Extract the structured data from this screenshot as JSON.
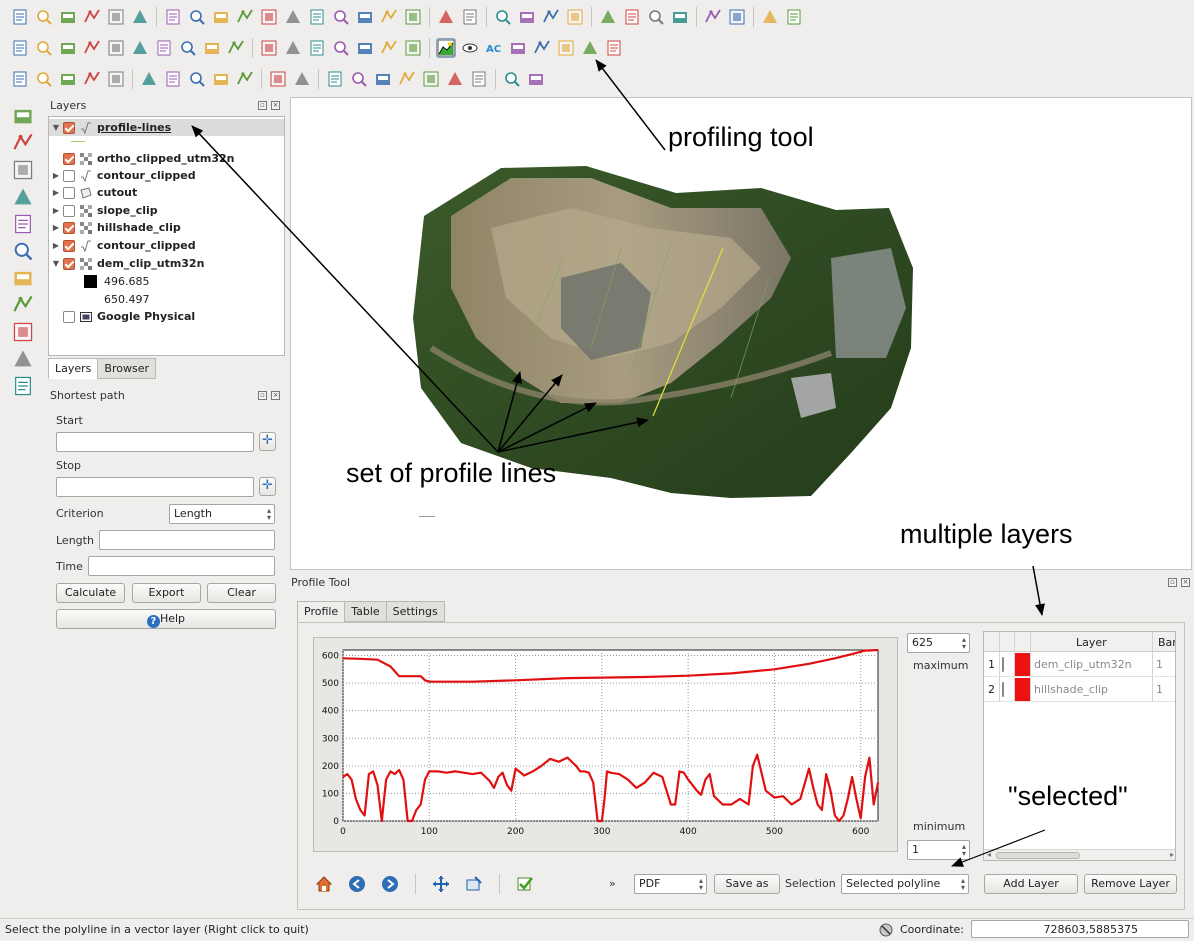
{
  "toolbar_rows": {
    "row1": [
      "new-project-icon",
      "open-project-icon",
      "save-project-icon",
      "save-as-icon",
      "new-print-composer-icon",
      "composer-manager-icon",
      "pan-icon",
      "pan-to-selection-icon",
      "zoom-in-icon",
      "zoom-out-icon",
      "zoom-actual-icon",
      "zoom-full-icon",
      "zoom-to-selection-icon",
      "zoom-to-layer-icon",
      "zoom-last-icon",
      "zoom-next-icon",
      "refresh-icon",
      "identify-icon",
      "action-icon",
      "select-features-icon",
      "deselect-icon",
      "expression-select-icon",
      "attribute-table-icon",
      "field-calculator-icon",
      "measure-icon",
      "map-tips-icon",
      "new-bookmark-icon",
      "show-bookmarks-icon",
      "text-annotation-icon",
      "help-icon",
      "whats-this-icon"
    ],
    "row2": [
      "digitize-icon",
      "edit-pencil-icon",
      "save-edits-icon",
      "add-feature-icon",
      "move-feature-icon",
      "node-tool-icon",
      "delete-selected-icon",
      "cut-features-icon",
      "copy-features-icon",
      "paste-features-icon",
      "label-icon",
      "label-pin-icon",
      "label-show-hide-icon",
      "label-move-icon",
      "label-rotate-icon",
      "label-change-icon",
      "label-highlight-icon",
      "profile-tool-icon",
      "eye-icon",
      "ac-icon",
      "binoculars-icon",
      "flag-icon",
      "terrain-icon",
      "contour-icon",
      "scatter-icon"
    ],
    "row3": [
      "add-vector-layer-icon",
      "add-raster-layer-icon",
      "add-postgis-icon",
      "add-spatialite-icon",
      "add-mssql-icon",
      "add-oracle-icon",
      "add-wms-icon",
      "add-wcs-icon",
      "add-wfs-icon",
      "add-delimited-icon",
      "new-shapefile-icon",
      "new-spatialite-icon",
      "simplify-icon",
      "add-ring-icon",
      "add-part-icon",
      "fill-ring-icon",
      "reshape-icon",
      "offset-curve-icon",
      "split-features-icon",
      "capture-icon",
      "capture-polygon-icon"
    ]
  },
  "left_toolbar": [
    "digitize-vertex-icon",
    "raster-grid-icon",
    "database-icon",
    "feather-icon",
    "shape-icon",
    "globe-icon",
    "globe2-icon",
    "globe3-icon",
    "route-icon",
    "vertex-add-icon",
    "rectangle-red-icon"
  ],
  "layers_panel": {
    "title": "Layers",
    "items": [
      {
        "name": "profile-lines",
        "checked": true,
        "expanded": true,
        "type": "line"
      },
      {
        "name": "ortho_clipped_utm32n",
        "checked": true,
        "expanded": false,
        "type": "raster"
      },
      {
        "name": "contour_clipped",
        "checked": false,
        "expanded": false,
        "type": "line"
      },
      {
        "name": "cutout",
        "checked": false,
        "expanded": false,
        "type": "polygon"
      },
      {
        "name": "slope_clip",
        "checked": false,
        "expanded": false,
        "type": "raster"
      },
      {
        "name": "hillshade_clip",
        "checked": true,
        "expanded": false,
        "type": "raster"
      },
      {
        "name": "contour_clipped",
        "checked": true,
        "expanded": false,
        "type": "line"
      },
      {
        "name": "dem_clip_utm32n",
        "checked": true,
        "expanded": true,
        "type": "raster"
      },
      {
        "name": "Google Physical",
        "checked": false,
        "expanded": false,
        "type": "web"
      }
    ],
    "dem_legend": {
      "min": "496.685",
      "max": "650.497"
    },
    "tabs": [
      "Layers",
      "Browser"
    ]
  },
  "shortest_path": {
    "title": "Shortest path",
    "start_label": "Start",
    "stop_label": "Stop",
    "criterion_label": "Criterion",
    "criterion_value": "Length",
    "length_label": "Length",
    "time_label": "Time",
    "calculate": "Calculate",
    "export": "Export",
    "clear": "Clear",
    "help": "Help"
  },
  "profile_tool": {
    "title": "Profile Tool",
    "tabs": [
      "Profile",
      "Table",
      "Settings"
    ],
    "max_value": "625",
    "max_label": "maximum",
    "min_value": "1",
    "min_label": "minimum",
    "format": "PDF",
    "save_as": "Save as",
    "selection_label": "Selection",
    "selection_value": "Selected polyline",
    "add_layer": "Add Layer",
    "remove_layer": "Remove Layer",
    "more_glyph": "»",
    "table_headers": [
      "Layer",
      "Bar"
    ],
    "table_rows": [
      {
        "idx": "1",
        "layer": "dem_clip_utm32n",
        "band": "1",
        "color": "#ee1111"
      },
      {
        "idx": "2",
        "layer": "hillshade_clip",
        "band": "1",
        "color": "#ee1111"
      }
    ]
  },
  "chart_data": {
    "type": "line",
    "xlabel": "",
    "ylabel": "",
    "xlim": [
      0,
      620
    ],
    "ylim": [
      0,
      620
    ],
    "x_ticks": [
      0,
      100,
      200,
      300,
      400,
      500,
      600
    ],
    "y_ticks": [
      0,
      100,
      200,
      300,
      400,
      500,
      600
    ],
    "series": [
      {
        "color": "#e01010",
        "x": [
          0,
          20,
          40,
          55,
          65,
          75,
          90,
          95,
          100,
          150,
          200,
          260,
          300,
          350,
          400,
          450,
          500,
          540,
          570,
          590,
          605,
          620
        ],
        "y": [
          590,
          588,
          585,
          560,
          525,
          525,
          525,
          510,
          505,
          505,
          510,
          518,
          520,
          522,
          527,
          535,
          550,
          570,
          590,
          605,
          618,
          625
        ]
      },
      {
        "color": "#e01010",
        "x": [
          0,
          5,
          10,
          15,
          20,
          25,
          30,
          35,
          40,
          45,
          50,
          55,
          60,
          65,
          70,
          75,
          80,
          85,
          90,
          95,
          100,
          110,
          120,
          130,
          140,
          150,
          160,
          170,
          175,
          180,
          185,
          190,
          195,
          200,
          210,
          220,
          230,
          240,
          250,
          260,
          270,
          275,
          280,
          285,
          290,
          295,
          300,
          303,
          306,
          310,
          320,
          330,
          340,
          350,
          360,
          370,
          380,
          385,
          390,
          395,
          400,
          410,
          415,
          420,
          425,
          430,
          440,
          450,
          460,
          470,
          475,
          480,
          490,
          500,
          510,
          520,
          530,
          540,
          545,
          550,
          555,
          560,
          565,
          570,
          575,
          580,
          585,
          590,
          595,
          600,
          605,
          610,
          615,
          620
        ],
        "y": [
          160,
          170,
          150,
          80,
          40,
          20,
          170,
          180,
          130,
          0,
          150,
          180,
          170,
          185,
          150,
          0,
          0,
          40,
          60,
          150,
          180,
          180,
          175,
          180,
          175,
          170,
          175,
          145,
          120,
          160,
          175,
          130,
          110,
          190,
          165,
          180,
          200,
          225,
          215,
          230,
          200,
          180,
          180,
          175,
          140,
          0,
          0,
          80,
          180,
          175,
          170,
          150,
          120,
          140,
          175,
          160,
          60,
          60,
          180,
          175,
          150,
          110,
          95,
          150,
          170,
          90,
          60,
          60,
          80,
          60,
          200,
          240,
          110,
          85,
          90,
          60,
          80,
          190,
          120,
          60,
          40,
          170,
          110,
          20,
          0,
          20,
          80,
          160,
          80,
          10,
          160,
          230,
          60,
          140
        ]
      }
    ]
  },
  "annotations": {
    "profiling_tool": "profiling tool",
    "profile_lines": "set of profile lines",
    "multiple_layers": "multiple layers",
    "selected": "\"selected\""
  },
  "statusbar": {
    "message": "Select the polyline in a vector layer (Right click to quit)",
    "coordinate_label": "Coordinate:",
    "coordinate_value": "728603,5885375"
  }
}
